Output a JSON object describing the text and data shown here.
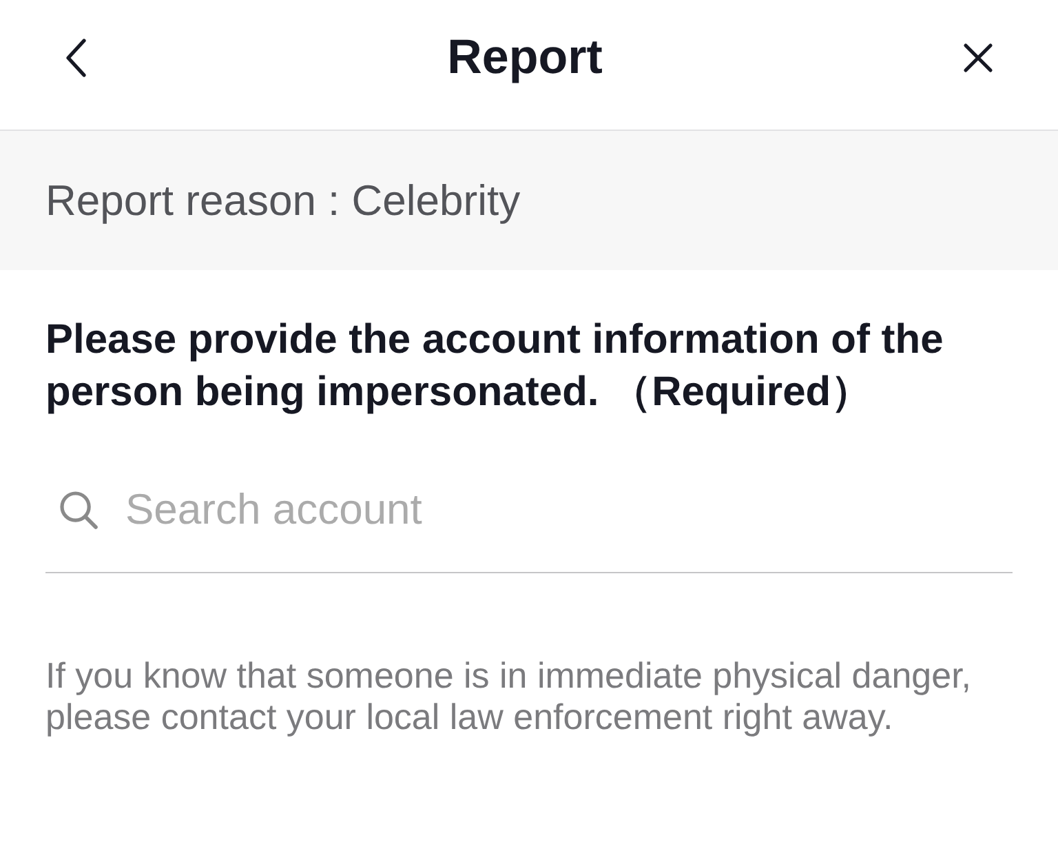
{
  "header": {
    "title": "Report"
  },
  "reason_bar": {
    "text": "Report reason : Celebrity"
  },
  "question": {
    "text": "Please provide the account information of the person being impersonated. （Required）"
  },
  "search": {
    "placeholder": "Search account"
  },
  "notice": {
    "text": "If you know that someone is in immediate physical danger, please contact your local law enforcement right away."
  }
}
